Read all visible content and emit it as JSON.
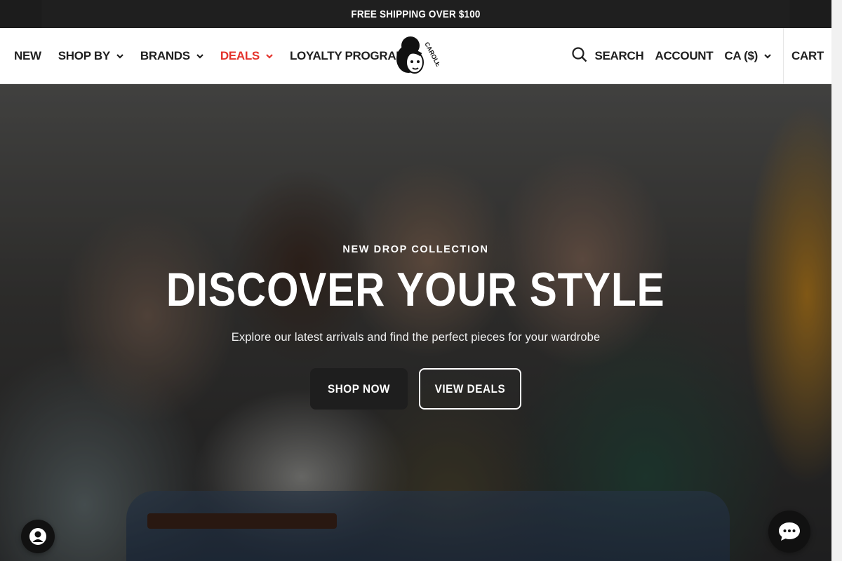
{
  "announcement": {
    "text": "FREE SHIPPING OVER $100"
  },
  "header": {
    "nav": [
      {
        "label": "NEW",
        "has_dropdown": false
      },
      {
        "label": "SHOP BY",
        "has_dropdown": true
      },
      {
        "label": "BRANDS",
        "has_dropdown": true
      },
      {
        "label": "DEALS",
        "has_dropdown": true,
        "color": "#e4322b"
      },
      {
        "label": "LOYALTY PROGRAM",
        "has_dropdown": false
      }
    ],
    "logo_text": "CAROLE",
    "search_label": "SEARCH",
    "account_label": "ACCOUNT",
    "currency_label": "CA ($)",
    "cart_label": "CART"
  },
  "hero": {
    "eyebrow": "NEW DROP COLLECTION",
    "headline": "DISCOVER YOUR STYLE",
    "subtext": "Explore our latest arrivals and find the perfect pieces for your wardrobe",
    "primary_cta": "SHOP NOW",
    "secondary_cta": "VIEW DEALS"
  },
  "widgets": {
    "account_icon": "user-circle-icon",
    "chat_icon": "chat-dots-icon"
  },
  "colors": {
    "accent_red": "#e4322b",
    "dark": "#1f1f1f",
    "white": "#ffffff"
  }
}
